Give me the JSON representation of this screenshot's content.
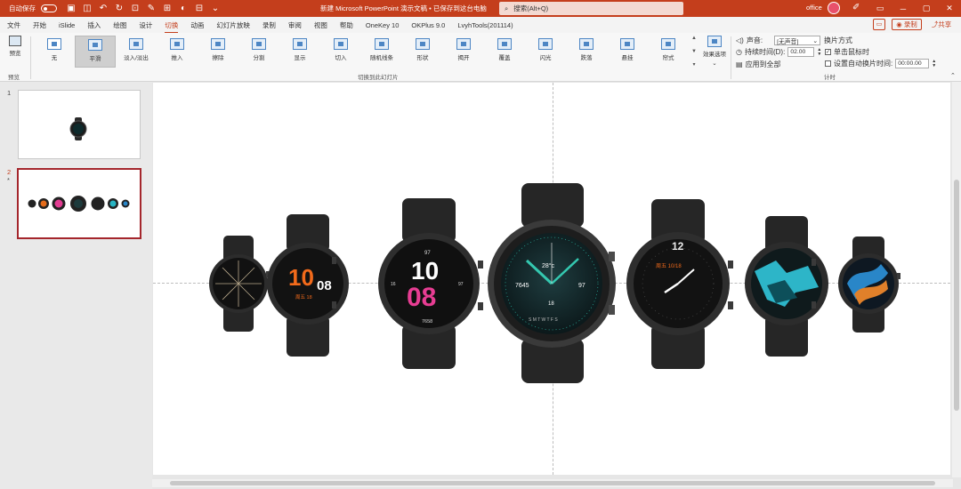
{
  "titlebar": {
    "autosave_label": "自动保存",
    "toggle_state": "关",
    "doc_title": "新建 Microsoft PowerPoint 演示文稿 • 已保存到这台电脑",
    "search_placeholder": "搜索(Alt+Q)",
    "user": "office",
    "brand_color": "#c43e1c"
  },
  "menu": {
    "tabs": [
      "文件",
      "开始",
      "iSlide",
      "插入",
      "绘图",
      "设计",
      "切换",
      "动画",
      "幻灯片放映",
      "录制",
      "审阅",
      "视图",
      "帮助",
      "OneKey 10",
      "OKPlus 9.0",
      "LvyhTools(201114)"
    ],
    "active_tab": "切换",
    "record": "录制",
    "share": "共享"
  },
  "ribbon": {
    "preview_label": "预览",
    "preview_group": "预览",
    "transitions": [
      "无",
      "平滑",
      "淡入/淡出",
      "推入",
      "擦除",
      "分割",
      "显示",
      "切入",
      "随机线条",
      "形状",
      "揭开",
      "覆盖",
      "闪光",
      "跌落",
      "悬挂",
      "帘式"
    ],
    "selected_transition": "平滑",
    "gallery_group": "切换到此幻灯片",
    "effect_options": "效果选项",
    "timing": {
      "sound_label": "声音:",
      "sound_value": "[无声音]",
      "duration_label": "持续时间(D):",
      "duration_value": "02.00",
      "apply_all": "应用到全部",
      "advance_title": "换片方式",
      "on_click": "单击鼠标时",
      "on_click_checked": true,
      "after_label": "设置自动换片时间:",
      "after_value": "00:00.00",
      "after_checked": false,
      "group_label": "计时"
    }
  },
  "slides": {
    "items": [
      {
        "number": "1",
        "star": ""
      },
      {
        "number": "2",
        "star": "*"
      }
    ],
    "selected": 2
  },
  "watch_faces": {
    "w2": {
      "hour": "10",
      "min": "08",
      "date": "周五 18"
    },
    "w3": {
      "top": "97",
      "hour": "10",
      "min": "08",
      "left": "16",
      "right": "97",
      "bottom": "7658"
    },
    "w4": {
      "top": "28°c",
      "left": "7645",
      "right": "97",
      "bottom": "18",
      "weekdays": "S M T W T F S"
    },
    "w5": {
      "date": "周五 10/18"
    }
  }
}
